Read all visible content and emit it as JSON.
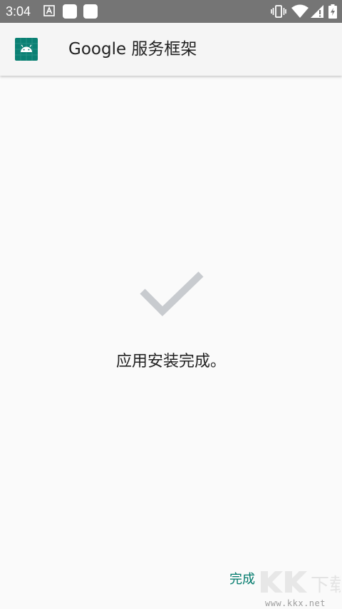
{
  "status_bar": {
    "time": "3:04",
    "left_icons": [
      "a-notification-icon",
      "notification-square-icon",
      "notification-square-icon"
    ],
    "right_icons": [
      "vibrate-icon",
      "wifi-icon",
      "no-sim-icon",
      "battery-charging-icon"
    ]
  },
  "app_bar": {
    "icon": "android-robot-icon",
    "title": "Google 服务框架"
  },
  "main": {
    "status_icon": "check-mark-icon",
    "message": "应用安装完成。"
  },
  "actions": {
    "done_label": "完成"
  },
  "watermark": {
    "url": "www.kkx.net"
  },
  "colors": {
    "status_bar": "#757575",
    "app_bar": "#f5f5f5",
    "background": "#fafafa",
    "accent": "#00796b",
    "app_icon": "#0a8073",
    "check_mark": "#c8cbcf"
  }
}
